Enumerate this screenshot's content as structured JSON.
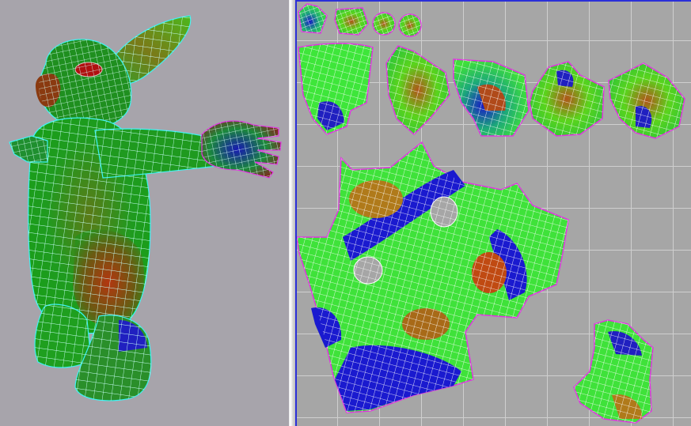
{
  "colors": {
    "viewport_bg": "#a7a4ab",
    "uv_bg": "#a6a6a6",
    "uv_grid": "#cfcfcf",
    "uv_frame": "#2b2fd8",
    "mesh_wire_cyan": "#3ef2f2",
    "mesh_wire_white": "#ffffff",
    "shell_outline": "#e034e0",
    "distortion_low": "#1a1acf",
    "distortion_mid": "#37e02a",
    "distortion_high": "#c6401a"
  },
  "icons": {
    "character": "rabbit-mesh-icon",
    "uv": "uv-shell-icon"
  }
}
